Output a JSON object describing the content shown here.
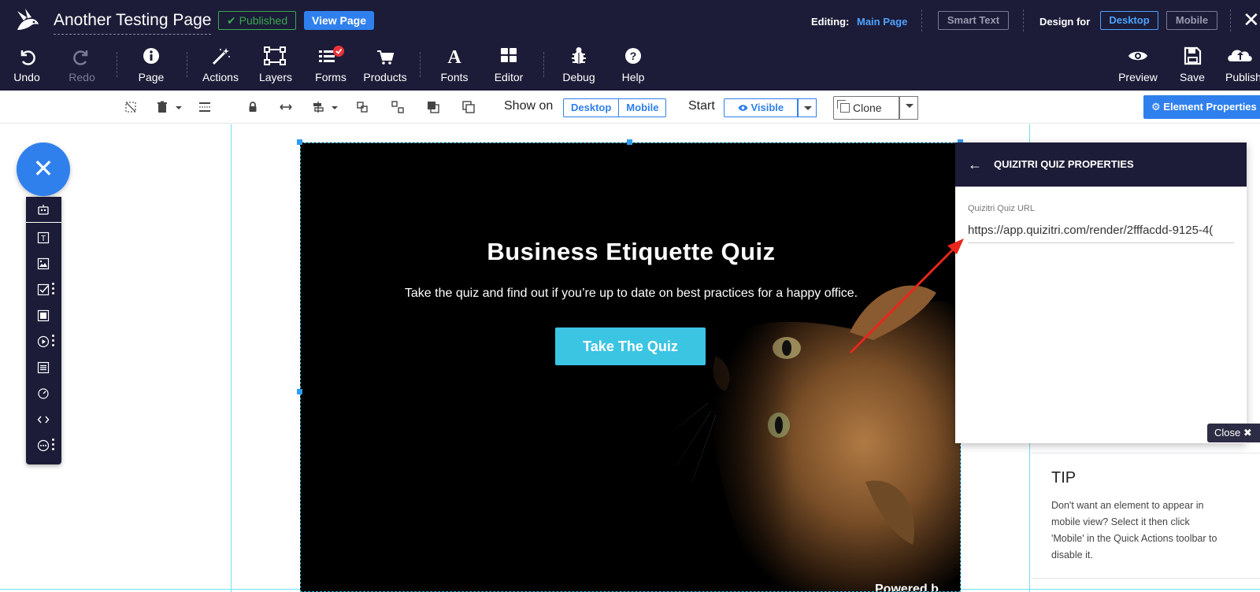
{
  "header": {
    "page_title": "Another Testing Page",
    "published_badge": "Published",
    "view_page_label": "View Page",
    "editing_label": "Editing:",
    "editing_value": "Main Page",
    "smart_text_label": "Smart Text",
    "design_for_label": "Design for",
    "desktop_label": "Desktop",
    "mobile_label": "Mobile",
    "close_glyph": "✕"
  },
  "toolbar": {
    "undo": "Undo",
    "redo": "Redo",
    "page": "Page",
    "actions": "Actions",
    "layers": "Layers",
    "forms": "Forms",
    "products": "Products",
    "fonts": "Fonts",
    "editor": "Editor",
    "debug": "Debug",
    "help": "Help",
    "preview": "Preview",
    "save": "Save",
    "publish": "Publish"
  },
  "quickbar": {
    "show_on_label": "Show on",
    "desktop": "Desktop",
    "mobile": "Mobile",
    "start_label": "Start",
    "visible": "Visible",
    "clone": "Clone",
    "element_properties": "Element Properties"
  },
  "canvas": {
    "fab_glyph": "✕",
    "hero_title": "Business Etiquette Quiz",
    "hero_subtitle": "Take the quiz and find out if you’re up to date on best practices for a happy office.",
    "hero_button": "Take The Quiz",
    "hero_footer_partial": "Powered b"
  },
  "panel": {
    "back_glyph": "←",
    "title": "QUIZITRI QUIZ PROPERTIES",
    "field_label": "Quizitri Quiz URL",
    "field_value": "https://app.quizitri.com/render/2fffacdd-9125-4(",
    "close_label": "Close ✖"
  },
  "tip": {
    "title": "TIP",
    "body": "Don't want an element to appear in mobile view? Select it then click 'Mobile' in the Quick Actions toolbar to disable it."
  },
  "colors": {
    "topbar_bg": "#1c1c38",
    "accent_blue": "#2f80ed",
    "published_green": "#3aa94d",
    "quiz_button": "#3cc4e3",
    "arrow_red": "#e8261c"
  }
}
